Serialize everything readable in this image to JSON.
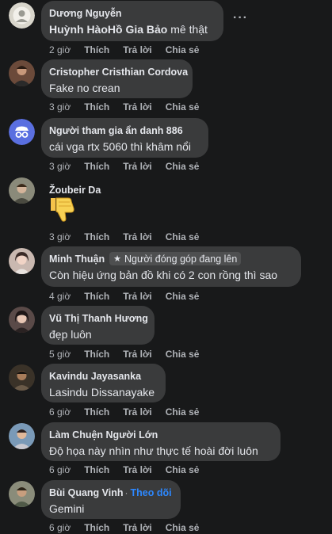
{
  "comments": [
    {
      "name": "Dương Nguyễn",
      "text_bold": "Huỳnh HàoHồ Gia Bảo",
      "text": " mê thật",
      "time": "2 giờ",
      "like": "Thích",
      "reply": "Trả lời",
      "share": "Chia sẻ"
    },
    {
      "name": "Cristopher Cristhian Cordova",
      "text": "Fake no crean",
      "time": "3 giờ",
      "like": "Thích",
      "reply": "Trả lời",
      "share": "Chia sẻ"
    },
    {
      "name": "Người tham gia ẩn danh 886",
      "text": "cái vga rtx 5060 thì khâm nổi",
      "time": "3 giờ",
      "like": "Thích",
      "reply": "Trả lời",
      "share": "Chia sẻ"
    },
    {
      "name": "Žoubeir Da",
      "sticker": "👎",
      "time": "3 giờ",
      "like": "Thích",
      "reply": "Trả lời",
      "share": "Chia sẻ"
    },
    {
      "name": "Minh Thuận",
      "badge": "Người đóng góp đang lên",
      "text": "Còn hiệu ứng bản đồ khi có 2 con rồng thì sao",
      "time": "4 giờ",
      "like": "Thích",
      "reply": "Trả lời",
      "share": "Chia sẻ"
    },
    {
      "name": "Vũ Thị Thanh Hương",
      "text": "đẹp luôn",
      "time": "5 giờ",
      "like": "Thích",
      "reply": "Trả lời",
      "share": "Chia sẻ"
    },
    {
      "name": "Kavindu Jayasanka",
      "text": "Lasindu Dissanayake",
      "time": "6 giờ",
      "like": "Thích",
      "reply": "Trả lời",
      "share": "Chia sẻ"
    },
    {
      "name": "Làm Chuện Người Lớn",
      "text": "Độ họa này nhìn như thực tế hoài đời luôn",
      "time": "6 giờ",
      "like": "Thích",
      "reply": "Trả lời",
      "share": "Chia sẻ"
    },
    {
      "name": "Bùi Quang Vinh",
      "follow": "Theo dõi",
      "text": "Gemini",
      "time": "6 giờ",
      "like": "Thích",
      "reply": "Trả lời",
      "share": "Chia sẻ"
    }
  ],
  "more_label": "···",
  "colors": {
    "background": "#18191a",
    "bubble": "#3a3b3c",
    "text": "#e4e6eb",
    "secondary": "#b0b3b8",
    "link": "#2d88ff"
  }
}
